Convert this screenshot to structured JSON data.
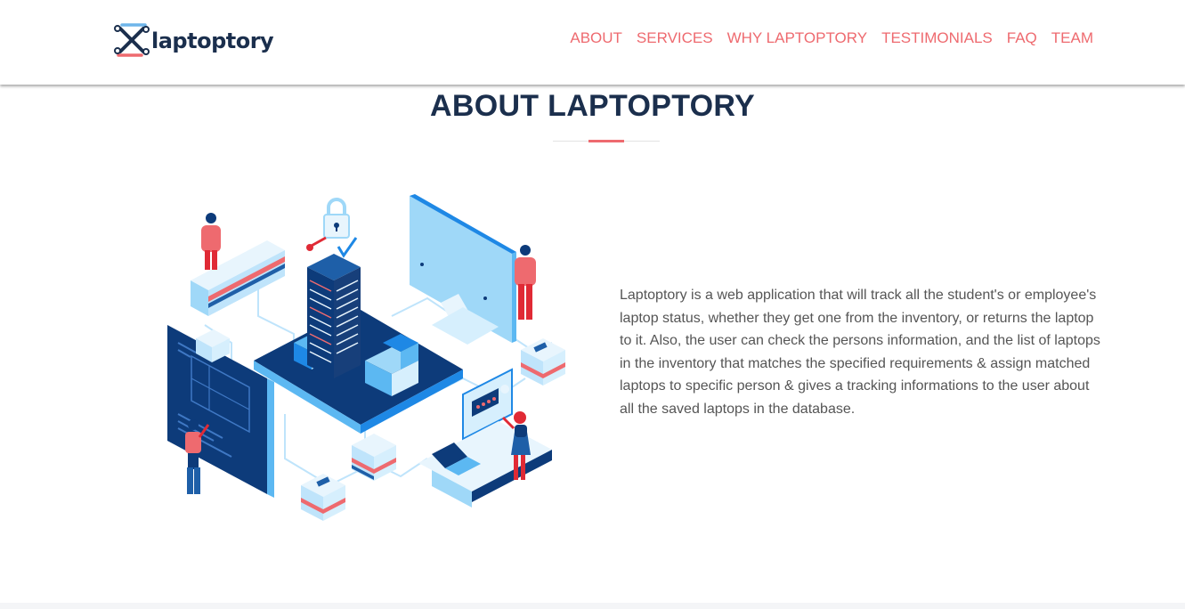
{
  "brand": {
    "name": "laptoptory"
  },
  "nav": {
    "items": [
      {
        "label": "ABOUT"
      },
      {
        "label": "SERVICES"
      },
      {
        "label": "WHY LAPTOPTORY"
      },
      {
        "label": "TESTIMONIALS"
      },
      {
        "label": "FAQ"
      },
      {
        "label": "TEAM"
      }
    ]
  },
  "about": {
    "title": "ABOUT LAPTOPTORY",
    "description": "Laptoptory is a web application that will track all the student's or employee's laptop status, whether they get one from the inventory, or returns the laptop to it. Also, the user can check the persons information, and the list of laptops in the inventory that matches the specified requirements & assign matched laptops to specific person & gives a tracking informations to the user about all the saved laptops in the database."
  },
  "colors": {
    "accent": "#ee6a6f",
    "navy": "#1b2f4d",
    "body_text": "#555555",
    "illustration_blue": "#1e88e5",
    "illustration_dark": "#0d3b7a",
    "illustration_light": "#9fd8f8"
  },
  "icons": {
    "logo": "laptoptory-logo-icon",
    "illustration": "isometric-inventory-illustration"
  }
}
